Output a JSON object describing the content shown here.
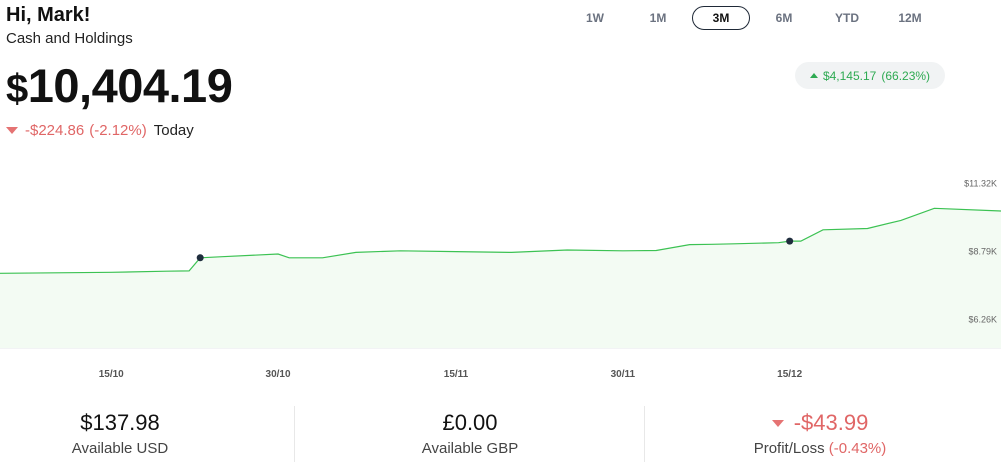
{
  "header": {
    "greeting": "Hi, Mark!",
    "subtitle": "Cash and Holdings",
    "balance_currency": "$",
    "balance_amount": "10,404.19",
    "today_change": "-$224.86",
    "today_pct": "(-2.12%)",
    "today_label": "Today"
  },
  "periods": {
    "items": [
      "1W",
      "1M",
      "3M",
      "6M",
      "YTD",
      "12M"
    ],
    "selected": "3M"
  },
  "gain": {
    "amount": "$4,145.17",
    "pct": "(66.23%)"
  },
  "colors": {
    "positive": "#2eaa52",
    "negative": "#e06666",
    "line": "#3cc253",
    "fill": "#f3fbf3"
  },
  "stats": {
    "usd_value": "$137.98",
    "usd_label": "Available USD",
    "gbp_value": "£0.00",
    "gbp_label": "Available GBP",
    "pl_value": "-$43.99",
    "pl_label": "Profit/Loss",
    "pl_pct": "(-0.43%)"
  },
  "chart_data": {
    "type": "area",
    "x_tick_labels": [
      "15/10",
      "30/10",
      "15/11",
      "30/11",
      "15/12"
    ],
    "y_tick_labels": [
      "$11.32K",
      "$8.79K",
      "$6.26K"
    ],
    "y_ticks": [
      11320,
      8790,
      6260
    ],
    "x": [
      "05/10",
      "10/10",
      "15/10",
      "20/10",
      "22/10",
      "23/10",
      "25/10",
      "30/10",
      "31/10",
      "03/11",
      "06/11",
      "10/11",
      "15/11",
      "20/11",
      "25/11",
      "30/11",
      "03/12",
      "06/12",
      "08/12",
      "10/12",
      "14/12",
      "15/12",
      "16/12",
      "18/12",
      "22/12",
      "25/12",
      "28/12",
      "03/01"
    ],
    "values": [
      7980,
      8000,
      8020,
      8060,
      8070,
      8560,
      8600,
      8700,
      8560,
      8560,
      8760,
      8820,
      8790,
      8760,
      8850,
      8820,
      8830,
      9050,
      9060,
      9080,
      9120,
      9180,
      9180,
      9600,
      9650,
      9950,
      10400,
      10300
    ],
    "markers": [
      "23/10",
      "15/12"
    ],
    "ylim": [
      5200,
      12200
    ]
  }
}
